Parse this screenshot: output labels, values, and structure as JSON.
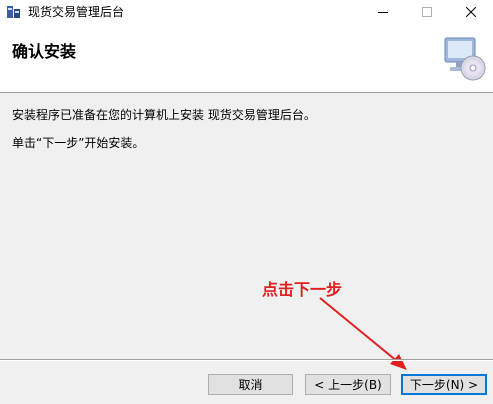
{
  "window": {
    "title": "现货交易管理后台"
  },
  "header": {
    "title": "确认安装"
  },
  "content": {
    "line1": "安装程序已准备在您的计算机上安装 现货交易管理后台。",
    "line2": "单击“下一步”开始安装。"
  },
  "annotation": {
    "text": "点击下一步",
    "color": "#e02020"
  },
  "buttons": {
    "cancel": "取消",
    "back": "< 上一步(B)",
    "next": "下一步(N) >"
  },
  "colors": {
    "accent": "#0078d7"
  }
}
